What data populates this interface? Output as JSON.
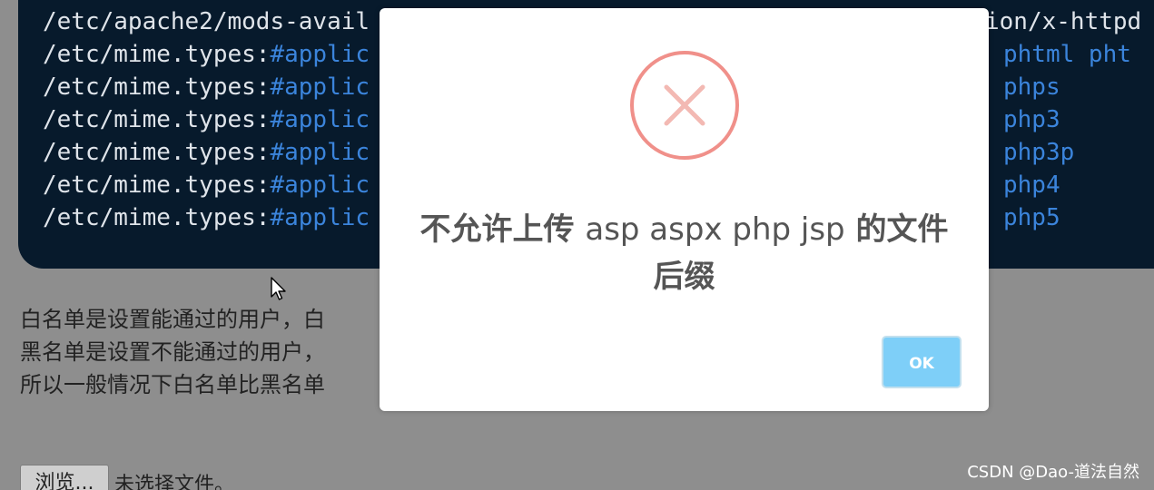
{
  "code": {
    "first_line": "/etc/apache2/mods-avail",
    "first_line_right": "ion/x-httpd",
    "lines": [
      {
        "prefix": "/etc/mime.types:",
        "hash": "#applic",
        "right": "phtml pht"
      },
      {
        "prefix": "/etc/mime.types:",
        "hash": "#applic",
        "right": "phps"
      },
      {
        "prefix": "/etc/mime.types:",
        "hash": "#applic",
        "right": "php3"
      },
      {
        "prefix": "/etc/mime.types:",
        "hash": "#applic",
        "right": "php3p"
      },
      {
        "prefix": "/etc/mime.types:",
        "hash": "#applic",
        "right": "php4"
      },
      {
        "prefix": "/etc/mime.types:",
        "hash": "#applic",
        "right": "php5"
      }
    ]
  },
  "description": [
    "白名单是设置能通过的用户，白",
    "黑名单是设置不能通过的用户，",
    "所以一般情况下白名单比黑名单"
  ],
  "file_input": {
    "browse_label": "浏览...",
    "status": "未选择文件。"
  },
  "dialog": {
    "icon": "error-x-icon",
    "title_prefix": "不允许上传",
    "title_ext": "asp aspx php jsp",
    "title_suffix": "的文件后缀",
    "ok_label": "OK"
  },
  "watermark": "CSDN @Dao-道法自然",
  "colors": {
    "code_bg": "#071a2c",
    "keyword": "#3b84db",
    "error_red": "#f0908a",
    "ok_button": "#7ecff8",
    "overlay": "#8e8e8e"
  }
}
